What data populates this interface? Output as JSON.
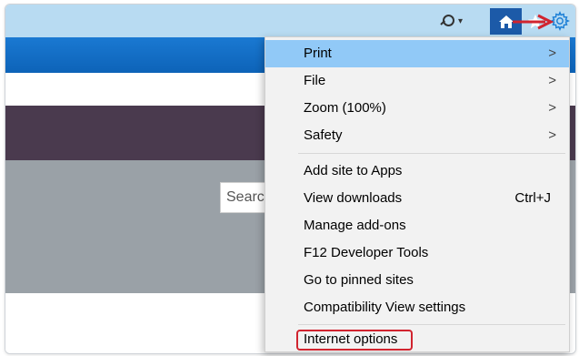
{
  "page": {
    "search_partial": "Searcl"
  },
  "toolbar": {
    "search_icon": "search-icon",
    "home_icon": "home-icon",
    "favorites_icon": "star-icon",
    "tools_icon": "gear-icon",
    "accent_color": "#1c5aa8",
    "annotation_color": "#d1242f"
  },
  "menu": {
    "items": [
      {
        "label": "Print",
        "submenu": ">",
        "state": "hover"
      },
      {
        "label": "File",
        "submenu": ">"
      },
      {
        "label": "Zoom (100%)",
        "submenu": ">"
      },
      {
        "label": "Safety",
        "submenu": ">"
      },
      {
        "label": "Add site to Apps"
      },
      {
        "label": "View downloads",
        "shortcut": "Ctrl+J"
      },
      {
        "label": "Manage add-ons"
      },
      {
        "label": "F12 Developer Tools"
      },
      {
        "label": "Go to pinned sites"
      },
      {
        "label": "Compatibility View settings"
      },
      {
        "label": "Internet options",
        "highlighted": true
      }
    ]
  }
}
